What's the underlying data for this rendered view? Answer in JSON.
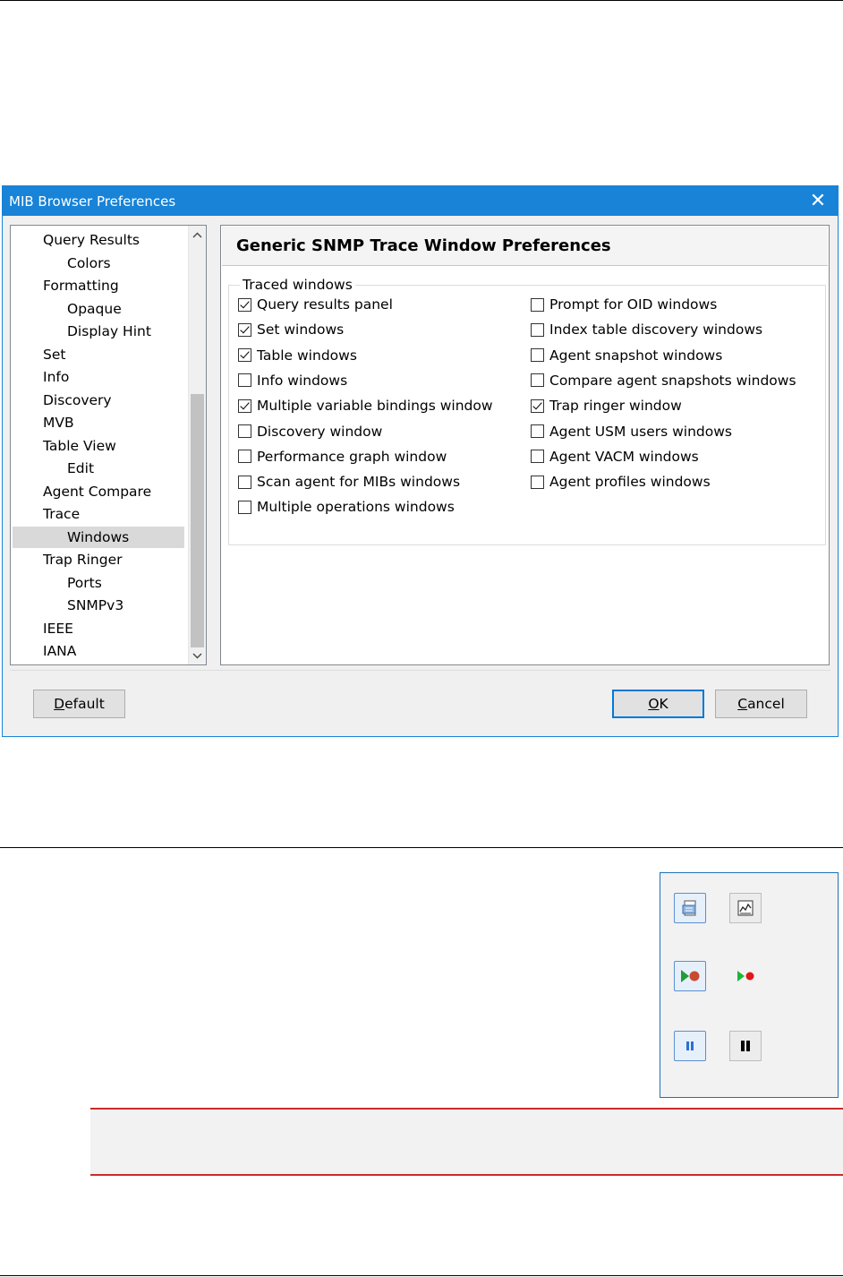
{
  "dialog": {
    "title": "MIB Browser Preferences",
    "close_glyph": "✕",
    "accent_color": "#1883d7"
  },
  "tree": {
    "items": [
      {
        "label": "Query Results",
        "level": 1
      },
      {
        "label": "Colors",
        "level": 2
      },
      {
        "label": "Formatting",
        "level": 1
      },
      {
        "label": "Opaque",
        "level": 2
      },
      {
        "label": "Display Hint",
        "level": 2
      },
      {
        "label": "Set",
        "level": 1
      },
      {
        "label": "Info",
        "level": 1
      },
      {
        "label": "Discovery",
        "level": 1
      },
      {
        "label": "MVB",
        "level": 1
      },
      {
        "label": "Table View",
        "level": 1
      },
      {
        "label": "Edit",
        "level": 2
      },
      {
        "label": "Agent Compare",
        "level": 1
      },
      {
        "label": "Trace",
        "level": 1
      },
      {
        "label": "Windows",
        "level": 2,
        "selected": true
      },
      {
        "label": "Trap Ringer",
        "level": 1
      },
      {
        "label": "Ports",
        "level": 2
      },
      {
        "label": "SNMPv3",
        "level": 2
      },
      {
        "label": "IEEE",
        "level": 1
      },
      {
        "label": "IANA",
        "level": 1
      }
    ]
  },
  "panel": {
    "heading": "Generic SNMP Trace Window Preferences",
    "group_label": "Traced windows",
    "left_column": [
      {
        "label": "Query results panel",
        "checked": true
      },
      {
        "label": "Set windows",
        "checked": true
      },
      {
        "label": "Table windows",
        "checked": true
      },
      {
        "label": "Info windows",
        "checked": false
      },
      {
        "label": "Multiple variable bindings window",
        "checked": true
      },
      {
        "label": "Discovery window",
        "checked": false
      },
      {
        "label": "Performance graph window",
        "checked": false
      },
      {
        "label": "Scan agent for MIBs windows",
        "checked": false
      },
      {
        "label": "Multiple operations windows",
        "checked": false
      }
    ],
    "right_column": [
      {
        "label": "Prompt for OID windows",
        "checked": false
      },
      {
        "label": "Index table discovery windows",
        "checked": false
      },
      {
        "label": "Agent snapshot windows",
        "checked": false
      },
      {
        "label": "Compare agent snapshots windows",
        "checked": false
      },
      {
        "label": "Trap ringer window",
        "checked": true
      },
      {
        "label": "Agent USM users windows",
        "checked": false
      },
      {
        "label": "Agent VACM windows",
        "checked": false
      },
      {
        "label": "Agent profiles windows",
        "checked": false
      }
    ]
  },
  "buttons": {
    "default": {
      "mnemonic": "D",
      "rest": "efault"
    },
    "ok": {
      "mnemonic": "O",
      "rest": "K"
    },
    "cancel": {
      "mnemonic": "C",
      "rest": "ancel"
    }
  },
  "icons": [
    {
      "name": "trace-window-icon",
      "style": "bordered"
    },
    {
      "name": "trace-window-graph-icon",
      "style": "plain"
    },
    {
      "name": "record-start-icon",
      "style": "bordered"
    },
    {
      "name": "record-start-small-icon",
      "style": "plain"
    },
    {
      "name": "pause-blue-icon",
      "style": "bordered"
    },
    {
      "name": "pause-black-icon",
      "style": "plain"
    }
  ]
}
